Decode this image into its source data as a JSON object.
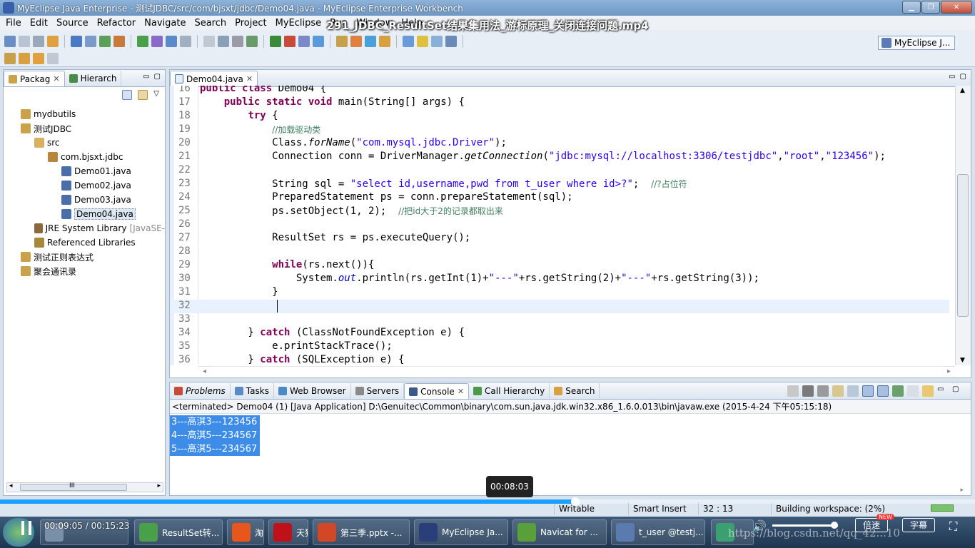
{
  "window": {
    "title": "MyEclipse Java Enterprise - 测试JDBC/src/com/bjsxt/jdbc/Demo04.java - MyEclipse Enterprise Workbench",
    "video_title": "291_JDBC_ResultSet结果集用法_游标原理_关闭连接问题.mp4"
  },
  "menu": [
    "File",
    "Edit",
    "Source",
    "Refactor",
    "Navigate",
    "Search",
    "Project",
    "MyEclipse",
    "Run",
    "Window",
    "Help"
  ],
  "perspective": "MyEclipse J...",
  "explorer": {
    "tabs": [
      {
        "label": "Packag"
      },
      {
        "label": "Hierarch"
      }
    ],
    "items": [
      {
        "label": "mydbutils",
        "indent": 0
      },
      {
        "label": "测试JDBC",
        "indent": 0
      },
      {
        "label": "src",
        "indent": 1
      },
      {
        "label": "com.bjsxt.jdbc",
        "indent": 2
      },
      {
        "label": "Demo01.java",
        "indent": 3
      },
      {
        "label": "Demo02.java",
        "indent": 3
      },
      {
        "label": "Demo03.java",
        "indent": 3
      },
      {
        "label": "Demo04.java",
        "indent": 3
      },
      {
        "label": "JRE System Library",
        "suffix": "[JavaSE-",
        "indent": 1
      },
      {
        "label": "Referenced Libraries",
        "indent": 1
      },
      {
        "label": "测试正则表达式",
        "indent": 0
      },
      {
        "label": "聚会通讯录",
        "indent": 0
      }
    ],
    "scroll_label": "III"
  },
  "editor": {
    "tab": "Demo04.java",
    "lines": [
      {
        "n": "16",
        "code": [
          {
            "t": "public ",
            "c": "kw"
          },
          {
            "t": "class ",
            "c": "kw"
          },
          {
            "t": "Demo04 {",
            "c": ""
          }
        ]
      },
      {
        "n": "17",
        "code": [
          {
            "t": "    ",
            "c": ""
          },
          {
            "t": "public ",
            "c": "kw"
          },
          {
            "t": "static ",
            "c": "kw"
          },
          {
            "t": "void ",
            "c": "kw"
          },
          {
            "t": "main(String[] args) {",
            "c": ""
          }
        ]
      },
      {
        "n": "18",
        "code": [
          {
            "t": "        ",
            "c": ""
          },
          {
            "t": "try ",
            "c": "kw"
          },
          {
            "t": "{",
            "c": ""
          }
        ]
      },
      {
        "n": "19",
        "code": [
          {
            "t": "            ",
            "c": ""
          },
          {
            "t": "//加载驱动类",
            "c": "cmt"
          }
        ]
      },
      {
        "n": "20",
        "code": [
          {
            "t": "            Class.",
            "c": ""
          },
          {
            "t": "forName",
            "c": "it"
          },
          {
            "t": "(",
            "c": ""
          },
          {
            "t": "\"com.mysql.jdbc.Driver\"",
            "c": "str"
          },
          {
            "t": ");",
            "c": ""
          }
        ]
      },
      {
        "n": "21",
        "code": [
          {
            "t": "            Connection conn = DriverManager.",
            "c": ""
          },
          {
            "t": "getConnection",
            "c": "it"
          },
          {
            "t": "(",
            "c": ""
          },
          {
            "t": "\"jdbc:mysql://localhost:3306/testjdbc\"",
            "c": "str"
          },
          {
            "t": ",",
            "c": ""
          },
          {
            "t": "\"root\"",
            "c": "str"
          },
          {
            "t": ",",
            "c": ""
          },
          {
            "t": "\"123456\"",
            "c": "str"
          },
          {
            "t": ");",
            "c": ""
          }
        ]
      },
      {
        "n": "22",
        "code": []
      },
      {
        "n": "23",
        "code": [
          {
            "t": "            String sql = ",
            "c": ""
          },
          {
            "t": "\"select id,username,pwd from t_user where id>?\"",
            "c": "str"
          },
          {
            "t": ";  ",
            "c": ""
          },
          {
            "t": "//?占位符",
            "c": "cmt"
          }
        ]
      },
      {
        "n": "24",
        "code": [
          {
            "t": "            PreparedStatement ps = conn.prepareStatement(sql);",
            "c": ""
          }
        ]
      },
      {
        "n": "25",
        "code": [
          {
            "t": "            ps.setObject(1, 2);  ",
            "c": ""
          },
          {
            "t": "//把id大于2的记录都取出来",
            "c": "cmt"
          }
        ]
      },
      {
        "n": "26",
        "code": []
      },
      {
        "n": "27",
        "code": [
          {
            "t": "            ResultSet rs = ps.executeQuery();",
            "c": ""
          }
        ]
      },
      {
        "n": "28",
        "code": []
      },
      {
        "n": "29",
        "code": [
          {
            "t": "            ",
            "c": ""
          },
          {
            "t": "while",
            "c": "kw"
          },
          {
            "t": "(rs.next()){",
            "c": ""
          }
        ]
      },
      {
        "n": "30",
        "code": [
          {
            "t": "                System.",
            "c": ""
          },
          {
            "t": "out",
            "c": "stat"
          },
          {
            "t": ".println(rs.getInt(1)+",
            "c": ""
          },
          {
            "t": "\"---\"",
            "c": "str"
          },
          {
            "t": "+rs.getString(2)+",
            "c": ""
          },
          {
            "t": "\"---\"",
            "c": "str"
          },
          {
            "t": "+rs.getString(3));",
            "c": ""
          }
        ]
      },
      {
        "n": "31",
        "code": [
          {
            "t": "            }",
            "c": ""
          }
        ]
      },
      {
        "n": "32",
        "code": [],
        "current": true
      },
      {
        "n": "33",
        "code": []
      },
      {
        "n": "34",
        "code": [
          {
            "t": "        } ",
            "c": ""
          },
          {
            "t": "catch ",
            "c": "kw"
          },
          {
            "t": "(ClassNotFoundException e) {",
            "c": ""
          }
        ]
      },
      {
        "n": "35",
        "code": [
          {
            "t": "            e.printStackTrace();",
            "c": ""
          }
        ]
      },
      {
        "n": "36",
        "code": [
          {
            "t": "        } ",
            "c": ""
          },
          {
            "t": "catch ",
            "c": "kw"
          },
          {
            "t": "(SQLException e) {",
            "c": ""
          }
        ]
      }
    ]
  },
  "console": {
    "tabs": [
      "Problems",
      "Tasks",
      "Web Browser",
      "Servers",
      "Console",
      "Call Hierarchy",
      "Search"
    ],
    "status": "<terminated> Demo04 (1) [Java Application] D:\\Genuitec\\Common\\binary\\com.sun.java.jdk.win32.x86_1.6.0.013\\bin\\javaw.exe (2015-4-24 下午05:15:18)",
    "output": [
      "3---高淇3---123456",
      "4---高淇5---234567",
      "5---高淇5---234567"
    ]
  },
  "statusbar": {
    "writable": "Writable",
    "insert_mode": "Smart Insert",
    "position": "32 : 13",
    "progress": "Building workspace: (2%)"
  },
  "video": {
    "hover_time": "00:08:03",
    "time": "00:09:05 / 00:15:23",
    "progress_fraction": 0.59,
    "hover_fraction": 0.523,
    "speed_label": "倍速",
    "new_badge": "NEW",
    "subtitle_label": "字幕",
    "watermark": "https://blog.csdn.net/qq_42...10"
  },
  "taskbar": [
    {
      "label": "",
      "color": "#7a8fa8"
    },
    {
      "label": "ResultSet转...",
      "color": "#4aa04a"
    },
    {
      "label": "淘",
      "color": "#e8561c"
    },
    {
      "label": "天猫",
      "color": "#c0101a"
    },
    {
      "label": "第三季.pptx -...",
      "color": "#d24726"
    },
    {
      "label": "MyEclipse Ja...",
      "color": "#2a3f7a"
    },
    {
      "label": "Navicat for ...",
      "color": "#5aa03a"
    },
    {
      "label": "t_user @testj...",
      "color": "#5a7ab0"
    },
    {
      "label": "",
      "color": "#3aa070"
    }
  ],
  "colors": {
    "accent": "#1aa0ff",
    "selection": "#3c8ce8",
    "keyword": "#7f0055",
    "string": "#2a00ff",
    "comment": "#3f7f5f"
  }
}
